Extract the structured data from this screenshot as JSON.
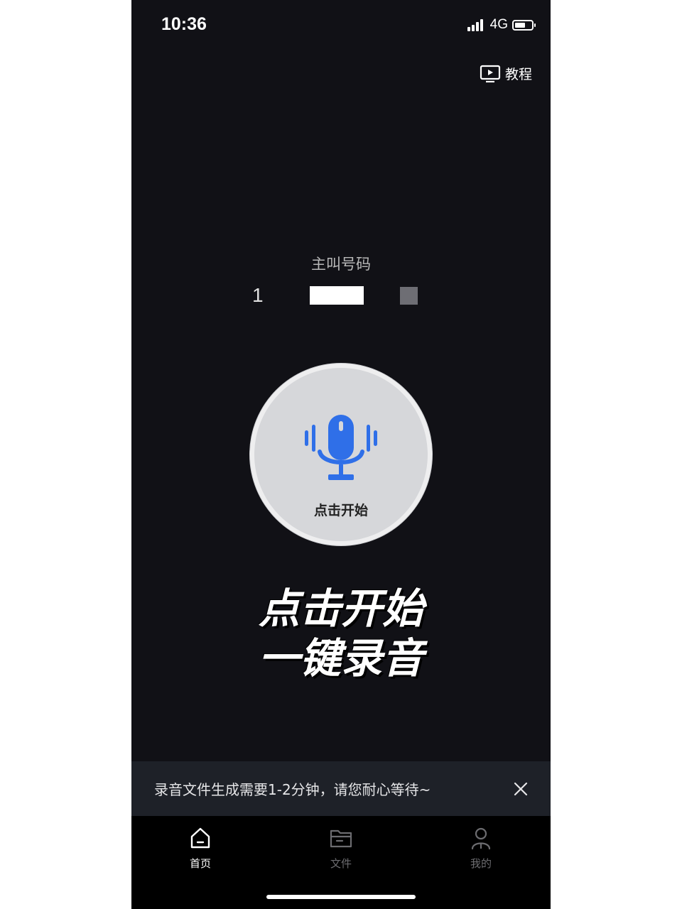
{
  "status_bar": {
    "time": "10:36",
    "network": "4G"
  },
  "header": {
    "tutorial_label": "教程"
  },
  "caller": {
    "label": "主叫号码",
    "number_fragment": "1"
  },
  "record_button": {
    "label": "点击开始"
  },
  "headline": {
    "line1": "点击开始",
    "line2": "一键录音"
  },
  "notice": {
    "text": "录音文件生成需要1-2分钟，请您耐心等待~"
  },
  "tabs": [
    {
      "label": "首页",
      "icon": "home-icon",
      "active": true
    },
    {
      "label": "文件",
      "icon": "folder-icon",
      "active": false
    },
    {
      "label": "我的",
      "icon": "user-icon",
      "active": false
    }
  ],
  "colors": {
    "background": "#111116",
    "accent_blue": "#2f6fe8",
    "notice_bg": "#1e2128",
    "button_bg": "#d6d7da"
  }
}
